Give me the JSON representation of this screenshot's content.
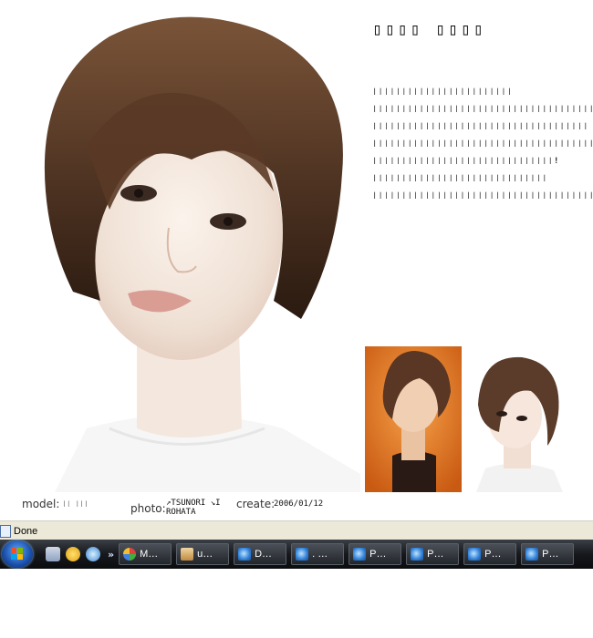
{
  "article": {
    "title": "▯▯▯▯ ▯▯▯▯",
    "lines": [
      "❘❘❘❘❘❘❘❘❘❘❘❘❘❘❘❘❘❘❘❘❘❘❘❘",
      "❘❘❘❘❘❘❘❘❘❘❘❘❘❘❘❘❘❘❘❘❘❘❘❘❘❘❘❘❘❘❘❘❘❘❘❘❘❘❘❘❘❘❘❘❘❘❘❘❘",
      "❘❘❘❘❘❘❘❘❘❘❘❘❘❘❘❘❘❘❘❘❘❘❘❘❘❘❘❘❘❘❘❘❘❘❘❘❘",
      "❘❘❘❘❘❘❘❘❘❘❘❘❘❘❘❘❘❘❘❘❘❘❘❘❘❘❘❘❘❘❘❘❘❘❘❘❘❘❘❘❘❘❘❘❘❘❘❘❘❘❘❘❘❘❘❘❘❘❘❘",
      "❘❘❘❘❘❘❘❘❘❘❘❘❘❘❘❘❘❘❘❘❘❘❘❘❘❘❘❘❘❘❘!",
      "❘❘❘❘❘❘❘❘❘❘❘❘❘❘❘❘❘❘❘❘❘❘❘❘❘❘❘❘❘❘",
      "❘❘❘❘❘❘❘❘❘❘❘❘❘❘❘❘❘❘❘❘❘❘❘❘❘❘❘❘❘❘❘❘❘❘❘❘❘❘❘❘❘❘❘❘"
    ]
  },
  "credits": {
    "model_label": "model:",
    "model_value": "❘❘ ❘❘❘",
    "photo_label": "photo:",
    "photo_value_line1": "↗TSUNORI ↘I",
    "photo_value_line2": "ROHATA",
    "create_label": "create:",
    "create_value": "2006/01/12"
  },
  "statusbar": {
    "text": "Done"
  },
  "taskbar": {
    "start_icon": "windows-start-orb",
    "quick_launch": [
      "show-desktop-icon",
      "clock-icon",
      "messenger-icon"
    ],
    "quick_overflow": "»",
    "tasks": [
      {
        "icon": "browser-globe-icon",
        "label": "M…"
      },
      {
        "icon": "uploader-icon",
        "label": "u…"
      },
      {
        "icon": "ie-icon",
        "label": "D…"
      },
      {
        "icon": "ie-icon",
        "label": ". …"
      },
      {
        "icon": "ie-icon",
        "label": "P…"
      },
      {
        "icon": "ie-icon",
        "label": "P…"
      },
      {
        "icon": "ie-icon",
        "label": "P…"
      },
      {
        "icon": "ie-icon",
        "label": "P…"
      }
    ]
  }
}
